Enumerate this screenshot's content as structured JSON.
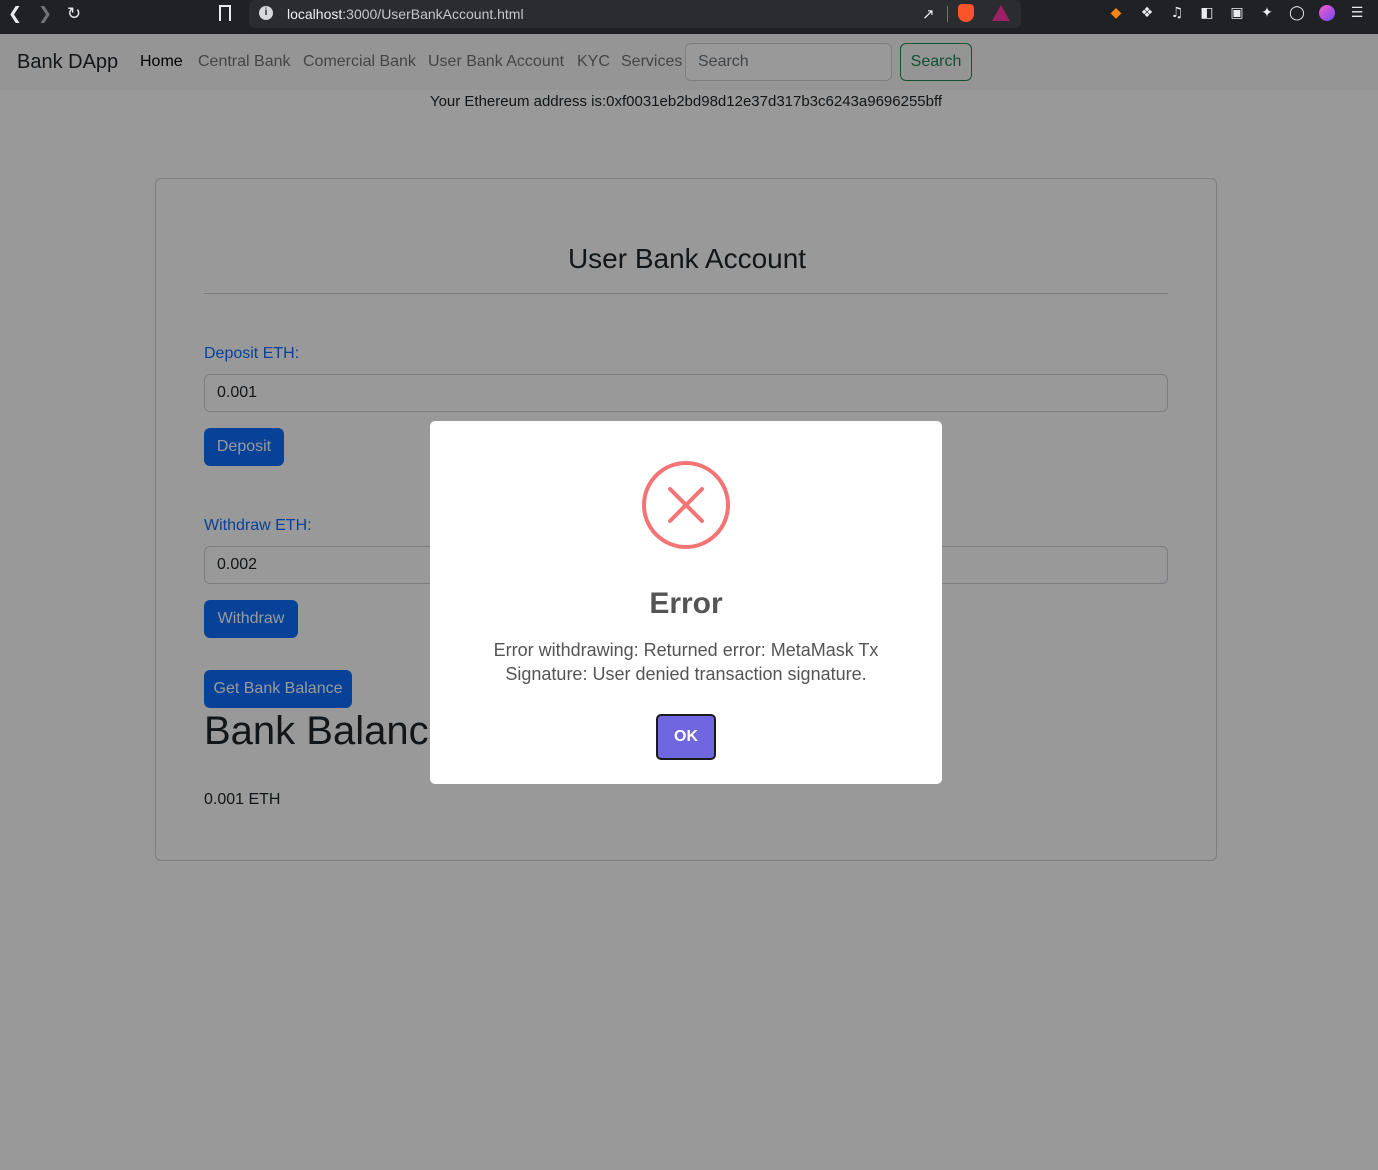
{
  "browser": {
    "url_host": "localhost",
    "url_rest": ":3000/UserBankAccount.html"
  },
  "navbar": {
    "brand": "Bank DApp",
    "links": [
      "Home",
      "Central Bank",
      "Comercial Bank",
      "User Bank Account",
      "KYC",
      "Services"
    ],
    "search_placeholder": "Search",
    "search_button": "Search"
  },
  "address_line": "Your Ethereum address is:0xf0031eb2bd98d12e37d317b3c6243a9696255bff",
  "card": {
    "title": "User Bank Account",
    "deposit_label": "Deposit ETH:",
    "deposit_value": "0.001",
    "deposit_button": "Deposit",
    "withdraw_label": "Withdraw ETH:",
    "withdraw_value": "0.002",
    "withdraw_button": "Withdraw",
    "balance_button": "Get Bank Balance",
    "balance_heading": "Bank Balance",
    "balance_value": "0.001 ETH"
  },
  "modal": {
    "icon": "error-x-icon",
    "title": "Error",
    "text": "Error withdrawing: Returned error: MetaMask Tx Signature: User denied transaction signature.",
    "ok_button": "OK"
  },
  "colors": {
    "primary": "#0d6efd",
    "success": "#198754",
    "error_icon": "#f27474",
    "confirm": "#7066e0"
  }
}
